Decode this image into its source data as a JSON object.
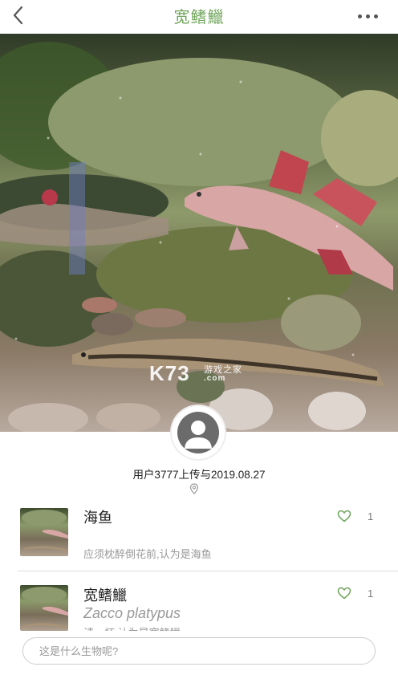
{
  "header": {
    "title": "宽鳍鱲",
    "back_icon": "chevron-left-icon",
    "more_icon": "more-dots-icon"
  },
  "hero": {
    "watermark_main": "K73",
    "watermark_sub": "游戏之家",
    "watermark_domain": ".com"
  },
  "uploader": {
    "text": "用户3777上传与2019.08.27",
    "location_icon": "location-pin-icon"
  },
  "answers": [
    {
      "title": "海鱼",
      "subtitle": "应须枕醉倒花前,认为是海鱼",
      "likes": "1"
    },
    {
      "title": "宽鳍鱲",
      "latin": "Zacco platypus",
      "subtitle": "请一杯 认为是宽鳍鱲",
      "likes": "1"
    }
  ],
  "input": {
    "placeholder": "这是什么生物呢?"
  },
  "colors": {
    "title": "#6fa55a",
    "heart": "#6fa55a"
  }
}
